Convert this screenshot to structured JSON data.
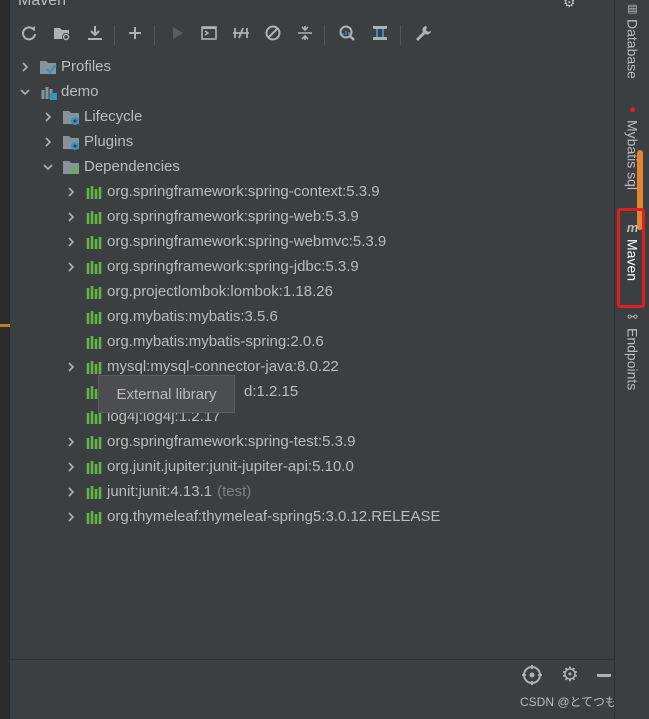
{
  "panel": {
    "title": "Maven"
  },
  "toolbar": {
    "icons": [
      "reload-icon",
      "generate-sources-icon",
      "download-icon",
      "add-icon",
      "run-icon",
      "execute-goal-icon",
      "toggle-offline-icon",
      "skip-tests-icon",
      "collapse-icon",
      "analyze-dependencies-icon",
      "show-diagram-icon",
      "settings-wrench-icon"
    ]
  },
  "tree": {
    "profiles": "Profiles",
    "demo": "demo",
    "lifecycle": "Lifecycle",
    "plugins": "Plugins",
    "dependencies": "Dependencies",
    "deps": [
      {
        "label": "org.springframework:spring-context:5.3.9",
        "expandable": true
      },
      {
        "label": "org.springframework:spring-web:5.3.9",
        "expandable": true
      },
      {
        "label": "org.springframework:spring-webmvc:5.3.9",
        "expandable": true
      },
      {
        "label": "org.springframework:spring-jdbc:5.3.9",
        "expandable": true
      },
      {
        "label": "org.projectlombok:lombok:1.18.26",
        "expandable": false
      },
      {
        "label": "org.mybatis:mybatis:3.5.6",
        "expandable": false
      },
      {
        "label": "org.mybatis:mybatis-spring:2.0.6",
        "expandable": false
      },
      {
        "label": "mysql:mysql-connector-java:8.0.22",
        "expandable": true
      },
      {
        "label": "d:1.2.15",
        "expandable": false
      },
      {
        "label": "log4j:log4j:1.2.17",
        "expandable": false
      },
      {
        "label": "org.springframework:spring-test:5.3.9",
        "expandable": true
      },
      {
        "label": "org.junit.jupiter:junit-jupiter-api:5.10.0",
        "expandable": true
      },
      {
        "label": "junit:junit:4.13.1",
        "expandable": true,
        "scope": "(test)"
      },
      {
        "label": "org.thymeleaf:thymeleaf-spring5:3.0.12.RELEASE",
        "expandable": true
      }
    ]
  },
  "tooltip": {
    "text": "External library"
  },
  "right_tabs": {
    "database": "Database",
    "mybatis": "Mybatis sql",
    "maven": "Maven",
    "endpoints": "Endpoints"
  },
  "watermark": "CSDN @とてつもなく",
  "colors": {
    "background": "#3c3f41",
    "text": "#bbbbbb",
    "highlight_border": "#e02020",
    "library_icon": "#62b543",
    "folder_icon": "#87939a"
  }
}
